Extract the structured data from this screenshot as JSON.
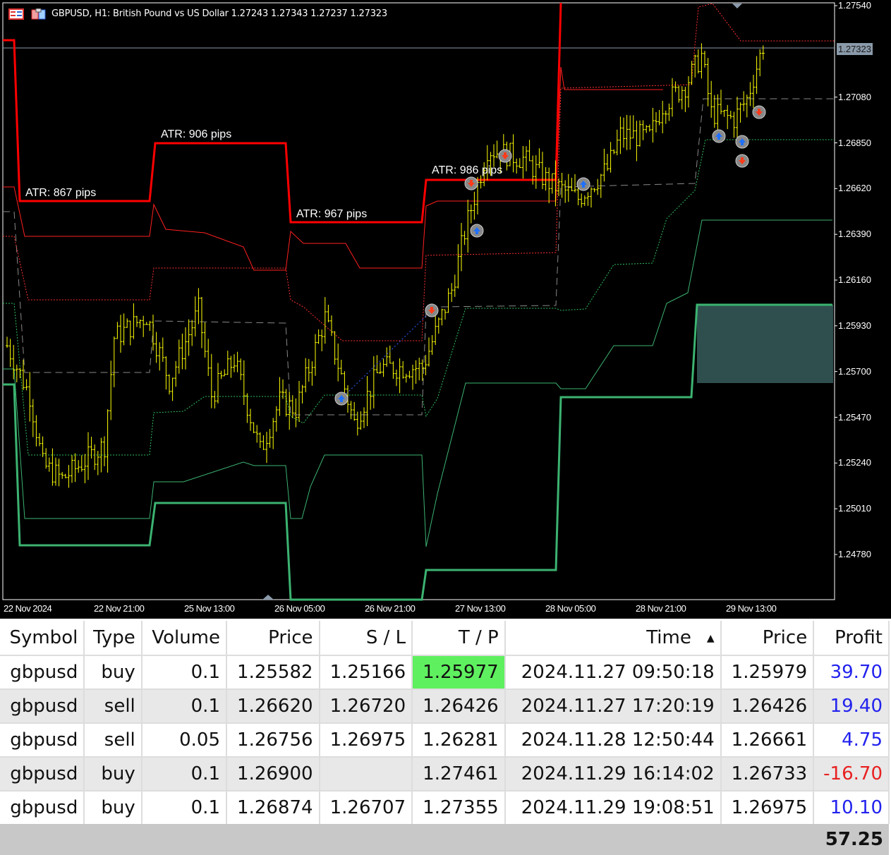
{
  "chart": {
    "title": "GBPUSD, H1:  British Pound vs US Dollar  1.27243 1.27343 1.27237 1.27323",
    "current_price": "1.27323",
    "atr_labels": [
      "ATR: 867 pips",
      "ATR: 906 pips",
      "ATR: 967 pips",
      "ATR: 986 pips"
    ],
    "price_axis": [
      "1.27540",
      "1.27080",
      "1.26850",
      "1.26620",
      "1.26390",
      "1.26160",
      "1.25930",
      "1.25700",
      "1.25470",
      "1.25240",
      "1.25010",
      "1.24780"
    ],
    "time_axis": [
      "22 Nov 2024",
      "22 Nov 21:00",
      "25 Nov 13:00",
      "26 Nov 05:00",
      "26 Nov 21:00",
      "27 Nov 13:00",
      "28 Nov 05:00",
      "28 Nov 21:00",
      "29 Nov 13:00"
    ],
    "price_range": [
      1.2478,
      1.2754
    ],
    "bars_path": [
      [
        0,
        1.2583
      ],
      [
        7,
        1.2558
      ],
      [
        11,
        1.2523
      ],
      [
        17,
        1.2516
      ],
      [
        30,
        1.2533
      ],
      [
        33,
        1.2587
      ],
      [
        43,
        1.2598
      ],
      [
        50,
        1.2565
      ],
      [
        59,
        1.2601
      ],
      [
        63,
        1.2558
      ],
      [
        70,
        1.2576
      ],
      [
        78,
        1.253
      ],
      [
        84,
        1.2555
      ],
      [
        89,
        1.2551
      ],
      [
        98,
        1.2597
      ],
      [
        107,
        1.2544
      ],
      [
        115,
        1.2572
      ],
      [
        128,
        1.2572
      ],
      [
        137,
        1.2611
      ],
      [
        141,
        1.264
      ],
      [
        148,
        1.2682
      ],
      [
        159,
        1.2677
      ],
      [
        167,
        1.2665
      ],
      [
        176,
        1.2657
      ],
      [
        185,
        1.2672
      ],
      [
        189,
        1.2689
      ],
      [
        198,
        1.2688
      ],
      [
        202,
        1.2704
      ],
      [
        209,
        1.2714
      ],
      [
        214,
        1.2729
      ],
      [
        217,
        1.27
      ],
      [
        224,
        1.2697
      ],
      [
        228,
        1.2707
      ],
      [
        233,
        1.2734
      ]
    ],
    "colors": {
      "upper": "#ff0000",
      "lower": "#3cb371",
      "bars": "#ffff00",
      "zone": "#2f4f4f"
    }
  },
  "table": {
    "headers": [
      "Symbol",
      "Type",
      "Volume",
      "Price",
      "S / L",
      "T / P",
      "Time",
      "Price",
      "Profit"
    ],
    "rows": [
      [
        "gbpusd",
        "buy",
        "0.1",
        "1.25582",
        "1.25166",
        "1.25977",
        "2024.11.27 09:50:18",
        "1.25979",
        "39.70"
      ],
      [
        "gbpusd",
        "sell",
        "0.1",
        "1.26620",
        "1.26720",
        "1.26426",
        "2024.11.27 17:20:19",
        "1.26426",
        "19.40"
      ],
      [
        "gbpusd",
        "sell",
        "0.05",
        "1.26756",
        "1.26975",
        "1.26281",
        "2024.11.28 12:50:44",
        "1.26661",
        "4.75"
      ],
      [
        "gbpusd",
        "buy",
        "0.1",
        "1.26900",
        "",
        "1.27461",
        "2024.11.29 16:14:02",
        "1.26733",
        "-16.70"
      ],
      [
        "gbpusd",
        "buy",
        "0.1",
        "1.26874",
        "1.26707",
        "1.27355",
        "2024.11.29 19:08:51",
        "1.26975",
        "10.10"
      ]
    ],
    "total": "57.25"
  }
}
